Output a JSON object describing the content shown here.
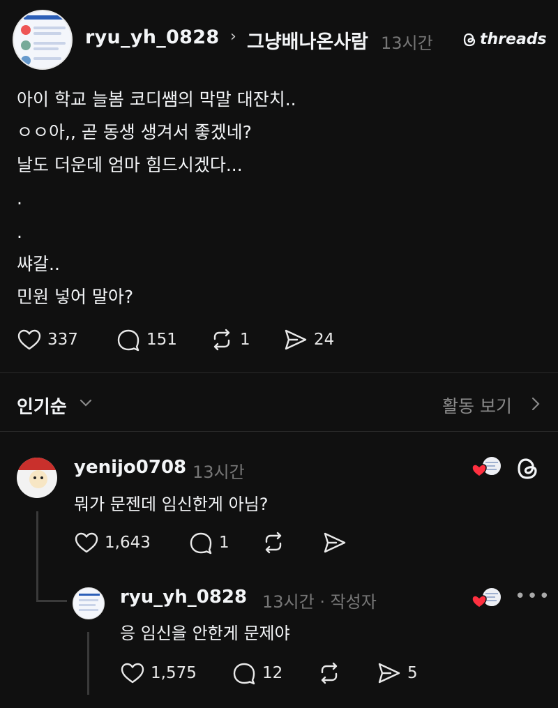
{
  "header": {
    "username": "ryu_yh_0828",
    "chevron": "›",
    "topic": "그냥배나온사람",
    "time": "13시간",
    "brand": "threads"
  },
  "post": {
    "lines": [
      "아이 학교 늘봄 코디쌤의 막말 대잔치..",
      "ㅇㅇ아,, 곧 동생 생겨서 좋겠네?",
      "날도 더운데 엄마 힘드시겠다...",
      ".",
      ".",
      "쌰갈..",
      "민원 넣어 말아?"
    ],
    "likes": "337",
    "comments": "151",
    "reposts": "1",
    "shares": "24"
  },
  "sort": {
    "label": "인기순",
    "activity": "활동 보기"
  },
  "comments": [
    {
      "username": "yenijo0708",
      "time": "13시간",
      "text": "뭐가 문젠데 임신한게 아님?",
      "likes": "1,643",
      "replies": "1"
    },
    {
      "username": "ryu_yh_0828",
      "time": "13시간 · 작성자",
      "text": "응 임신을 안한게 문제야",
      "likes": "1,575",
      "replies": "12",
      "shares": "5",
      "more": "•••"
    }
  ],
  "colors": {
    "background": "#101010",
    "text": "#f3f5f7",
    "muted": "#777777",
    "heart": "#ff3040"
  },
  "icons": [
    "heart-icon",
    "comment-icon",
    "repost-icon",
    "share-icon",
    "threads-logo-icon",
    "chevron-down-icon",
    "chevron-right-icon",
    "more-icon"
  ]
}
